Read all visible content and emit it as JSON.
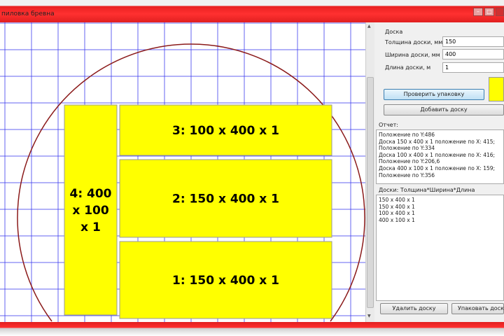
{
  "window": {
    "title": "пиловка бревна",
    "minimize": "–",
    "maximize": "□"
  },
  "canvas": {
    "grid_color": "#3333ee",
    "circle_color": "#8b1a1a",
    "board_color": "#ffff00",
    "boards": [
      {
        "label": "4: 400 x 100 x 1"
      },
      {
        "label": "3: 100 x 400 x 1"
      },
      {
        "label": "2: 150 x 400 x 1"
      },
      {
        "label": "1: 150 x 400 x 1"
      }
    ]
  },
  "panel": {
    "group_label": "Доска",
    "thickness_label": "Толщина доски, мм",
    "thickness_value": "150",
    "width_label": "Ширина доски, мм",
    "width_value": "400",
    "length_label": "Длина доски, м",
    "length_value": "1",
    "check_button": "Проверить упаковку",
    "add_button": "Добавить доску",
    "report_label": "Отчет:",
    "report_lines": [
      "Положение по Y:486",
      "Доска 150 x 400 x 1 положение по X: 415;",
      "Положение по Y:334",
      "Доска 100 x 400 x 1 положение по X: 416;",
      "Положение по Y:206,6",
      "Доска 400 x 100 x 1 положение по X: 159;",
      "Положение по Y:356"
    ],
    "boards_label": "Доски: Толщина*Ширина*Длина",
    "boards_list": [
      "150 x 400 x 1",
      "150 x 400 x 1",
      "100 x 400 x 1",
      "400 x 100 x 1"
    ],
    "delete_button": "Удалить доску",
    "pack_button": "Упаковать доски"
  }
}
